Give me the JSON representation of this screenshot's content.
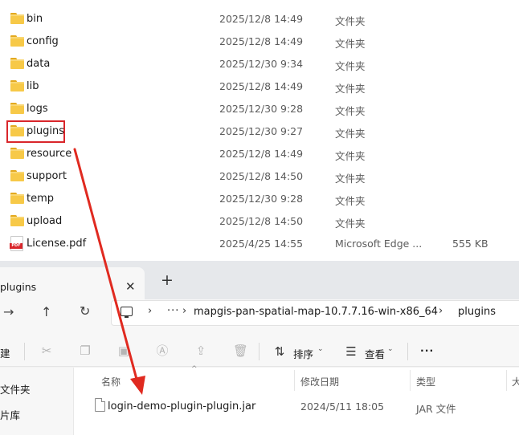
{
  "top_files": [
    {
      "name": "bin",
      "date": "2025/12/8 14:49",
      "type": "文件夹",
      "size": "",
      "icon": "folder-icon"
    },
    {
      "name": "config",
      "date": "2025/12/8 14:49",
      "type": "文件夹",
      "size": "",
      "icon": "folder-icon"
    },
    {
      "name": "data",
      "date": "2025/12/30 9:34",
      "type": "文件夹",
      "size": "",
      "icon": "folder-icon"
    },
    {
      "name": "lib",
      "date": "2025/12/8 14:49",
      "type": "文件夹",
      "size": "",
      "icon": "folder-icon"
    },
    {
      "name": "logs",
      "date": "2025/12/30 9:28",
      "type": "文件夹",
      "size": "",
      "icon": "folder-icon"
    },
    {
      "name": "plugins",
      "date": "2025/12/30 9:27",
      "type": "文件夹",
      "size": "",
      "icon": "folder-icon"
    },
    {
      "name": "resource",
      "date": "2025/12/8 14:49",
      "type": "文件夹",
      "size": "",
      "icon": "folder-icon"
    },
    {
      "name": "support",
      "date": "2025/12/8 14:50",
      "type": "文件夹",
      "size": "",
      "icon": "folder-icon"
    },
    {
      "name": "temp",
      "date": "2025/12/30 9:28",
      "type": "文件夹",
      "size": "",
      "icon": "folder-icon"
    },
    {
      "name": "upload",
      "date": "2025/12/8 14:50",
      "type": "文件夹",
      "size": "",
      "icon": "folder-icon"
    },
    {
      "name": "License.pdf",
      "date": "2025/4/25 14:55",
      "type": "Microsoft Edge ...",
      "size": "555 KB",
      "icon": "pdf-icon"
    }
  ],
  "pdf_badge": "PDF",
  "explorer": {
    "tab_title": "plugins",
    "tab_close": "✕",
    "tab_add": "+",
    "nav": {
      "forward": "→",
      "up": "↑",
      "refresh": "↻"
    },
    "address": {
      "more": "···",
      "chevron": "›",
      "crumbs": [
        "mapgis-pan-spatial-map-10.7.7.16-win-x86_64",
        "plugins"
      ]
    },
    "toolbar": {
      "new_partial": "建",
      "sort_label": "排序",
      "view_label": "查看",
      "more": "···"
    },
    "sidebar": [
      "文件夹",
      "片库"
    ],
    "columns": {
      "name": "名称",
      "date": "修改日期",
      "type": "类型",
      "size_partial": "大"
    },
    "files": [
      {
        "name": "login-demo-plugin-plugin.jar",
        "date": "2024/5/11 18:05",
        "type": "JAR 文件"
      }
    ]
  },
  "colors": {
    "highlight": "#d9262b",
    "folder": "#f7c948",
    "arrow": "#e02a20"
  }
}
